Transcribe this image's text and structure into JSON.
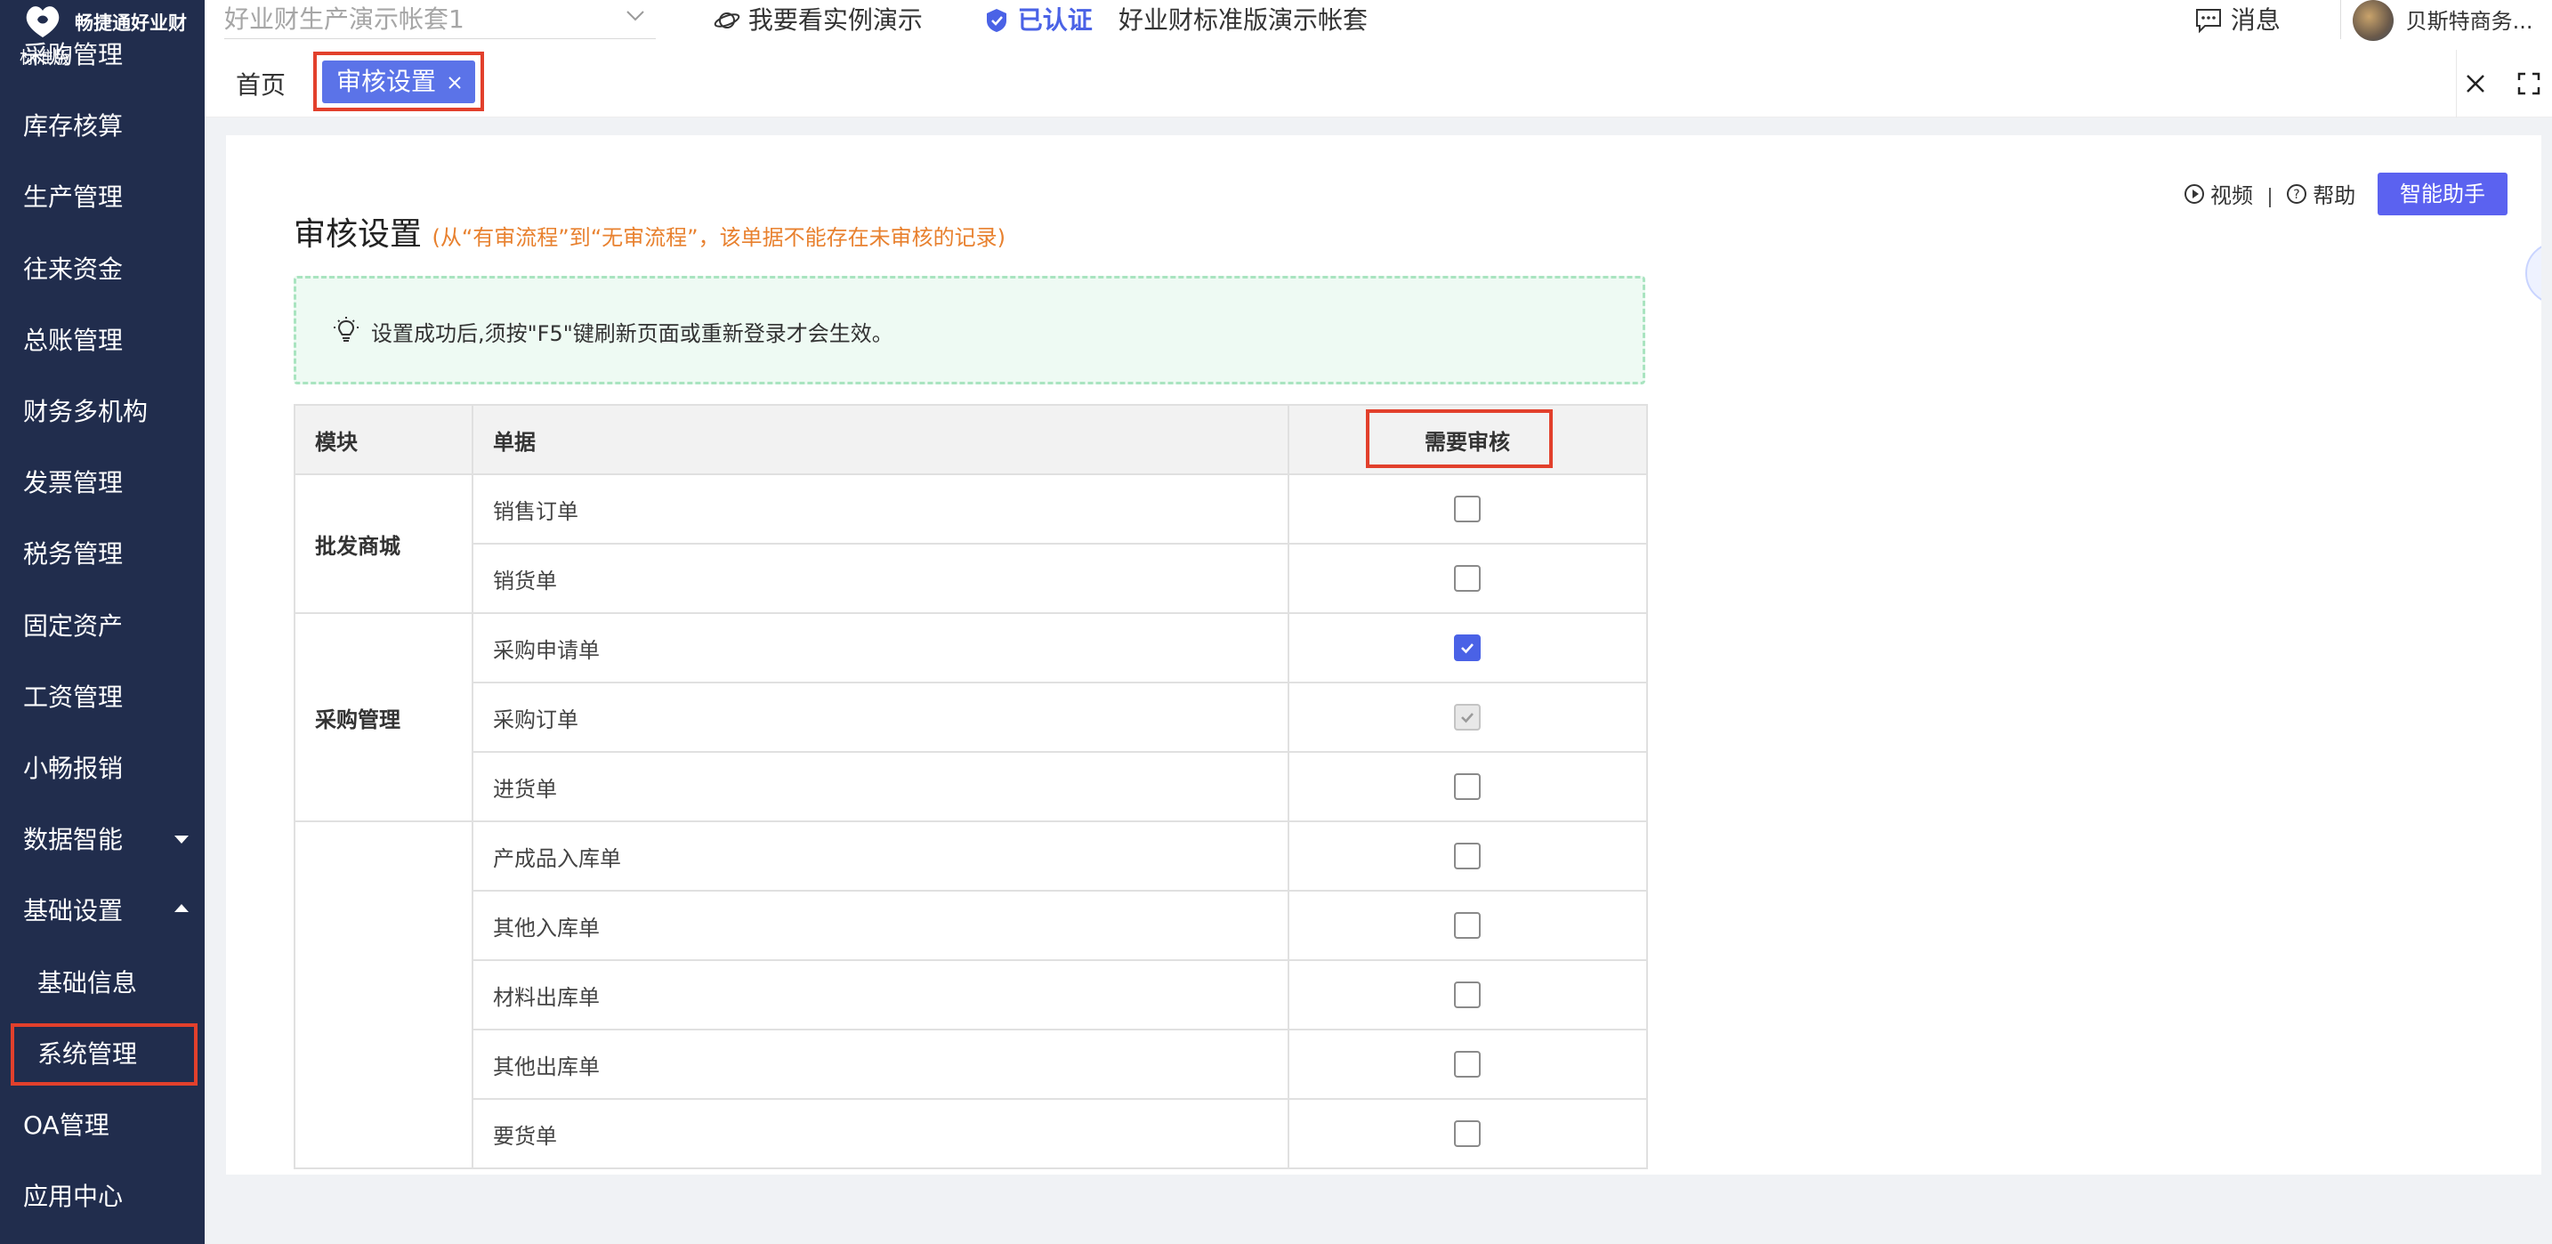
{
  "sidebar": {
    "brand_name": "畅捷通好业财",
    "edition": "标准版",
    "items": [
      {
        "label": "采购管理"
      },
      {
        "label": "库存核算"
      },
      {
        "label": "生产管理"
      },
      {
        "label": "往来资金"
      },
      {
        "label": "总账管理"
      },
      {
        "label": "财务多机构"
      },
      {
        "label": "发票管理"
      },
      {
        "label": "税务管理"
      },
      {
        "label": "固定资产"
      },
      {
        "label": "工资管理"
      },
      {
        "label": "小畅报销"
      },
      {
        "label": "数据智能",
        "caret": "down"
      },
      {
        "label": "基础设置",
        "caret": "up"
      },
      {
        "label": "基础信息",
        "sub": true
      },
      {
        "label": "系统管理",
        "sub": true,
        "highlighted": true
      },
      {
        "label": "OA管理"
      },
      {
        "label": "应用中心"
      }
    ]
  },
  "topbar": {
    "account_select_value": "好业财生产演示帐套1",
    "demo_link": "我要看实例演示",
    "verified_label": "已认证",
    "account_name": "好业财标准版演示帐套",
    "messages_label": "消息",
    "user_name": "贝斯特商务..."
  },
  "tabs": {
    "home": "首页",
    "active": "审核设置"
  },
  "page": {
    "title": "审核设置",
    "title_note": "(从“有审流程”到“无审流程”，该单据不能存在未审核的记录)",
    "video_label": "视频",
    "help_label": "帮助",
    "assistant_label": "智能助手",
    "tip": "设置成功后,须按\"F5\"键刷新页面或重新登录才会生效。"
  },
  "table": {
    "headers": [
      "模块",
      "单据",
      "需要审核"
    ],
    "groups": [
      {
        "module": "批发商城",
        "rows": [
          {
            "doc": "销售订单",
            "state": "unchecked"
          },
          {
            "doc": "销货单",
            "state": "unchecked"
          }
        ]
      },
      {
        "module": "采购管理",
        "rows": [
          {
            "doc": "采购申请单",
            "state": "checked"
          },
          {
            "doc": "采购订单",
            "state": "checked-disabled"
          },
          {
            "doc": "进货单",
            "state": "unchecked"
          }
        ]
      },
      {
        "module": "",
        "rows": [
          {
            "doc": "产成品入库单",
            "state": "unchecked"
          },
          {
            "doc": "其他入库单",
            "state": "unchecked"
          },
          {
            "doc": "材料出库单",
            "state": "unchecked"
          },
          {
            "doc": "其他出库单",
            "state": "unchecked"
          },
          {
            "doc": "要货单",
            "state": "unchecked"
          }
        ]
      }
    ]
  },
  "colors": {
    "sidebar_bg": "#212d4d",
    "accent": "#5b73e8",
    "highlight_outline": "#e2402c",
    "note_orange": "#e8812f",
    "tip_bg": "#eefaf3"
  }
}
